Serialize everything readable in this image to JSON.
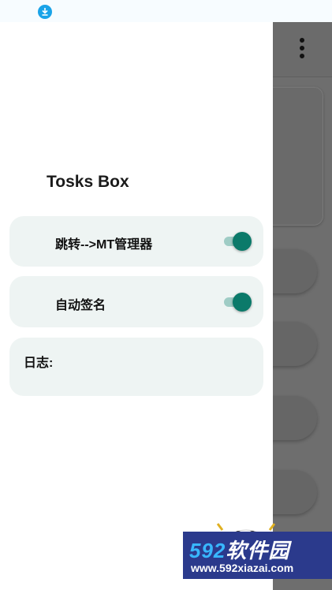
{
  "drawer": {
    "title": "Tosks Box",
    "settings": [
      {
        "label": "跳转-->MT管理器",
        "enabled": true
      },
      {
        "label": "自动签名",
        "enabled": true
      }
    ],
    "log_label": "日志:"
  },
  "colors": {
    "accent": "#0b7a6a",
    "track": "#9fccc5",
    "card_bg": "#eef4f3",
    "scrim": "#6e6e6e"
  },
  "icons": {
    "status_download": "download-icon",
    "app_menu": "overflow-menu-icon"
  },
  "watermark": {
    "logo_digits": "592",
    "logo_text": "软件园",
    "url": "www.592xiazai.com"
  }
}
